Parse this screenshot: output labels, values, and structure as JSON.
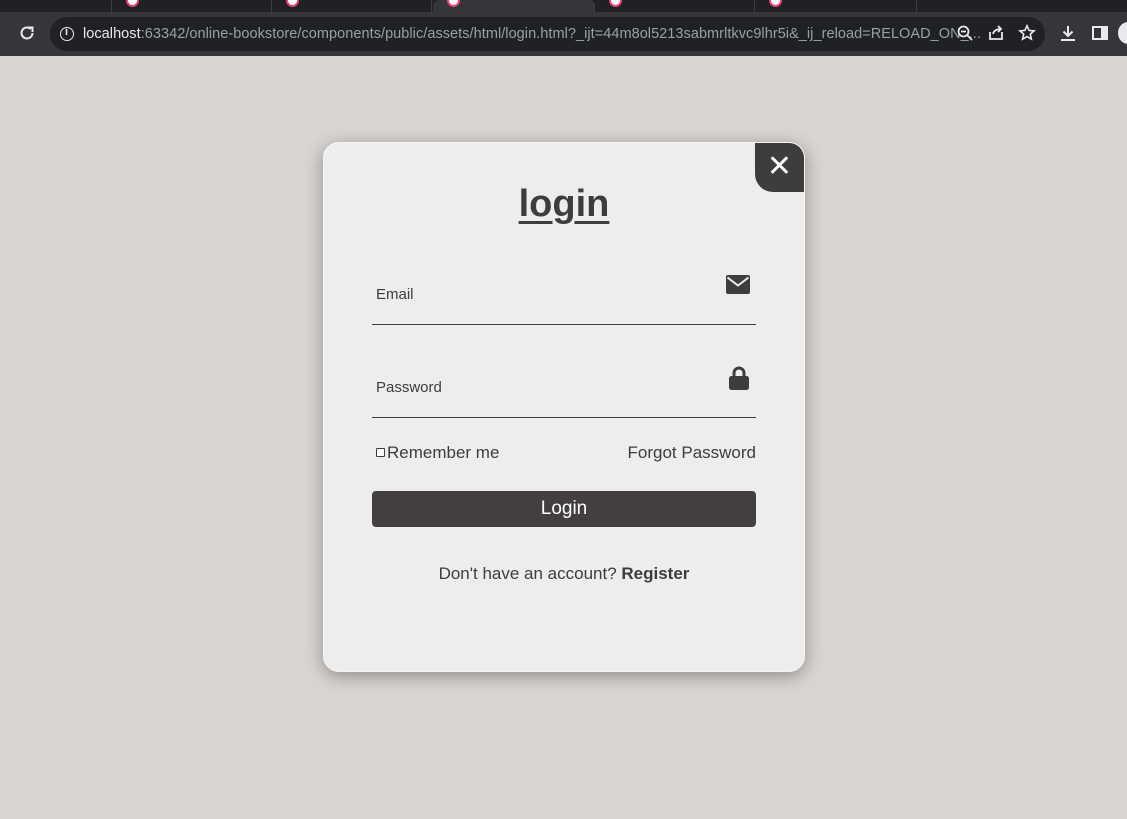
{
  "browser": {
    "url_host": "localhost",
    "url_rest": ":63342/online-bookstore/components/public/assets/html/login.html?_ijt=44m8ol5213sabmrltkvc9lhr5i&_ij_reload=RELOAD_ON_...",
    "icons": [
      "reload-icon",
      "info-icon",
      "zoom-out-icon",
      "share-icon",
      "star-icon",
      "download-icon",
      "side-panel-icon"
    ]
  },
  "login_form": {
    "title": "login",
    "close_label": "✕",
    "email_label": "Email",
    "password_label": "Password",
    "remember_label": "Remember me",
    "forgot_label": "Forgot Password",
    "submit_label": "Login",
    "no_account_text": "Don't have an account? ",
    "register_label": "Register"
  },
  "colors": {
    "page_background": "#d9d5d2",
    "modal_background": "#ededed",
    "accent_dark": "#3f3c3d",
    "button_text": "#ffffff"
  }
}
